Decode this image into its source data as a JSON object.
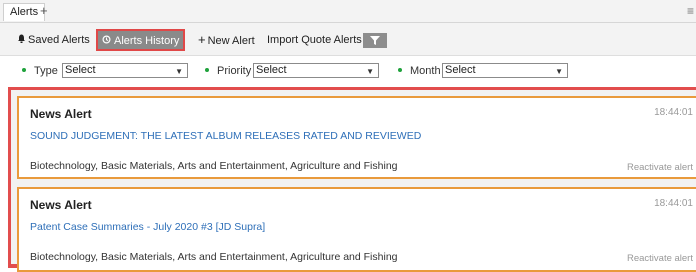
{
  "tabs": {
    "active_label": "Alerts",
    "add_label": "+",
    "menu_label": "≡"
  },
  "toolbar": {
    "saved_alerts": "Saved Alerts",
    "alerts_history": "Alerts History",
    "new_alert": "New Alert",
    "import_quote_alerts": "Import Quote Alerts"
  },
  "filters": {
    "type": {
      "label": "Type",
      "value": "Select"
    },
    "priority": {
      "label": "Priority",
      "value": "Select"
    },
    "month": {
      "label": "Month",
      "value": "Select"
    }
  },
  "alerts": [
    {
      "title": "News Alert",
      "time": "18:44:01",
      "headline": "SOUND JUDGEMENT: THE LATEST ALBUM RELEASES RATED AND REVIEWED",
      "tags": "Biotechnology, Basic Materials, Arts and Entertainment, Agriculture and Fishing",
      "action": "Reactivate alert"
    },
    {
      "title": "News Alert",
      "time": "18:44:01",
      "headline": "Patent Case Summaries - July 2020 #3 [JD Supra]",
      "tags": "Biotechnology, Basic Materials, Arts and Entertainment, Agriculture and Fishing",
      "action": "Reactivate alert"
    }
  ],
  "colors": {
    "highlight": "#e24d4d",
    "card_border": "#e99a3c",
    "link": "#2e6fb8",
    "dot": "#1fa23c"
  }
}
